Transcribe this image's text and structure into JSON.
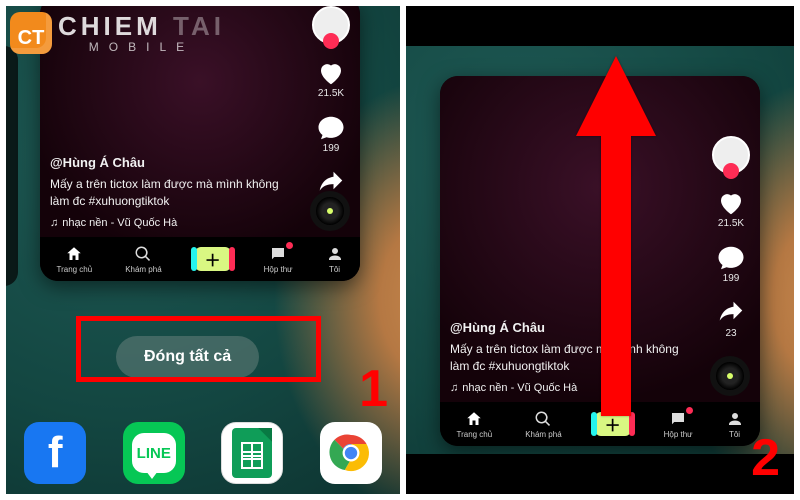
{
  "watermark": {
    "brand_part1": "CHIEM",
    "brand_part2": "TAI",
    "subtitle": "MOBILE",
    "badge": "CT"
  },
  "steps": {
    "one": "1",
    "two": "2"
  },
  "close_all_label": "Đóng tất cả",
  "tiktok": {
    "user": "@Hùng Á Châu",
    "caption": "Mấy a trên tictox làm được mà mình không làm đc #xuhuongtiktok",
    "music": "nhạc nền - Vũ Quốc Hà",
    "likes": "21.5K",
    "comments": "199",
    "shares": "23",
    "nav": {
      "home": "Trang chủ",
      "discover": "Khám phá",
      "inbox": "Hộp thư",
      "me": "Tôi"
    }
  },
  "dock": {
    "line_label": "LINE"
  }
}
